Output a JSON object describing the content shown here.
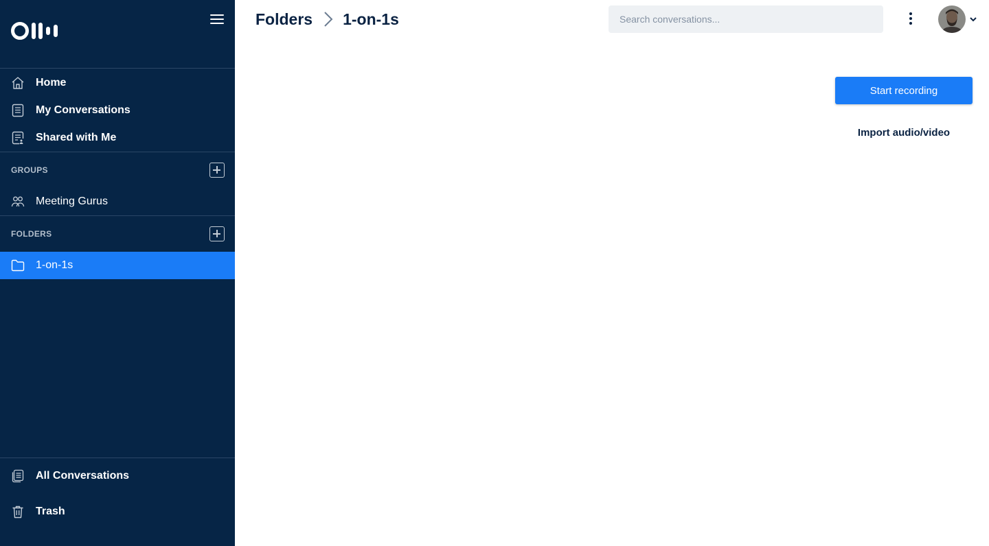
{
  "colors": {
    "sidebar_bg": "#062546",
    "accent": "#1a7cf7",
    "text_dark": "#0a2242",
    "search_bg": "#eef1f4"
  },
  "sidebar": {
    "logo_icon": "otter-logo",
    "menu_icon": "hamburger-icon",
    "nav": [
      {
        "label": "Home",
        "icon": "home-icon"
      },
      {
        "label": "My Conversations",
        "icon": "document-icon"
      },
      {
        "label": "Shared with Me",
        "icon": "shared-document-icon"
      }
    ],
    "groups": {
      "title": "GROUPS",
      "items": [
        {
          "label": "Meeting Gurus",
          "icon": "people-icon"
        }
      ]
    },
    "folders": {
      "title": "FOLDERS",
      "items": [
        {
          "label": "1-on-1s",
          "icon": "folder-icon",
          "active": true
        }
      ]
    },
    "bottom": [
      {
        "label": "All Conversations",
        "icon": "documents-stack-icon"
      },
      {
        "label": "Trash",
        "icon": "trash-icon"
      }
    ]
  },
  "header": {
    "breadcrumb": [
      "Folders",
      "1-on-1s"
    ],
    "search": {
      "placeholder": "Search conversations...",
      "value": ""
    },
    "more_icon": "kebab-menu-icon",
    "avatar_icon": "user-avatar"
  },
  "main": {
    "start_recording_label": "Start recording",
    "import_label": "Import audio/video"
  }
}
